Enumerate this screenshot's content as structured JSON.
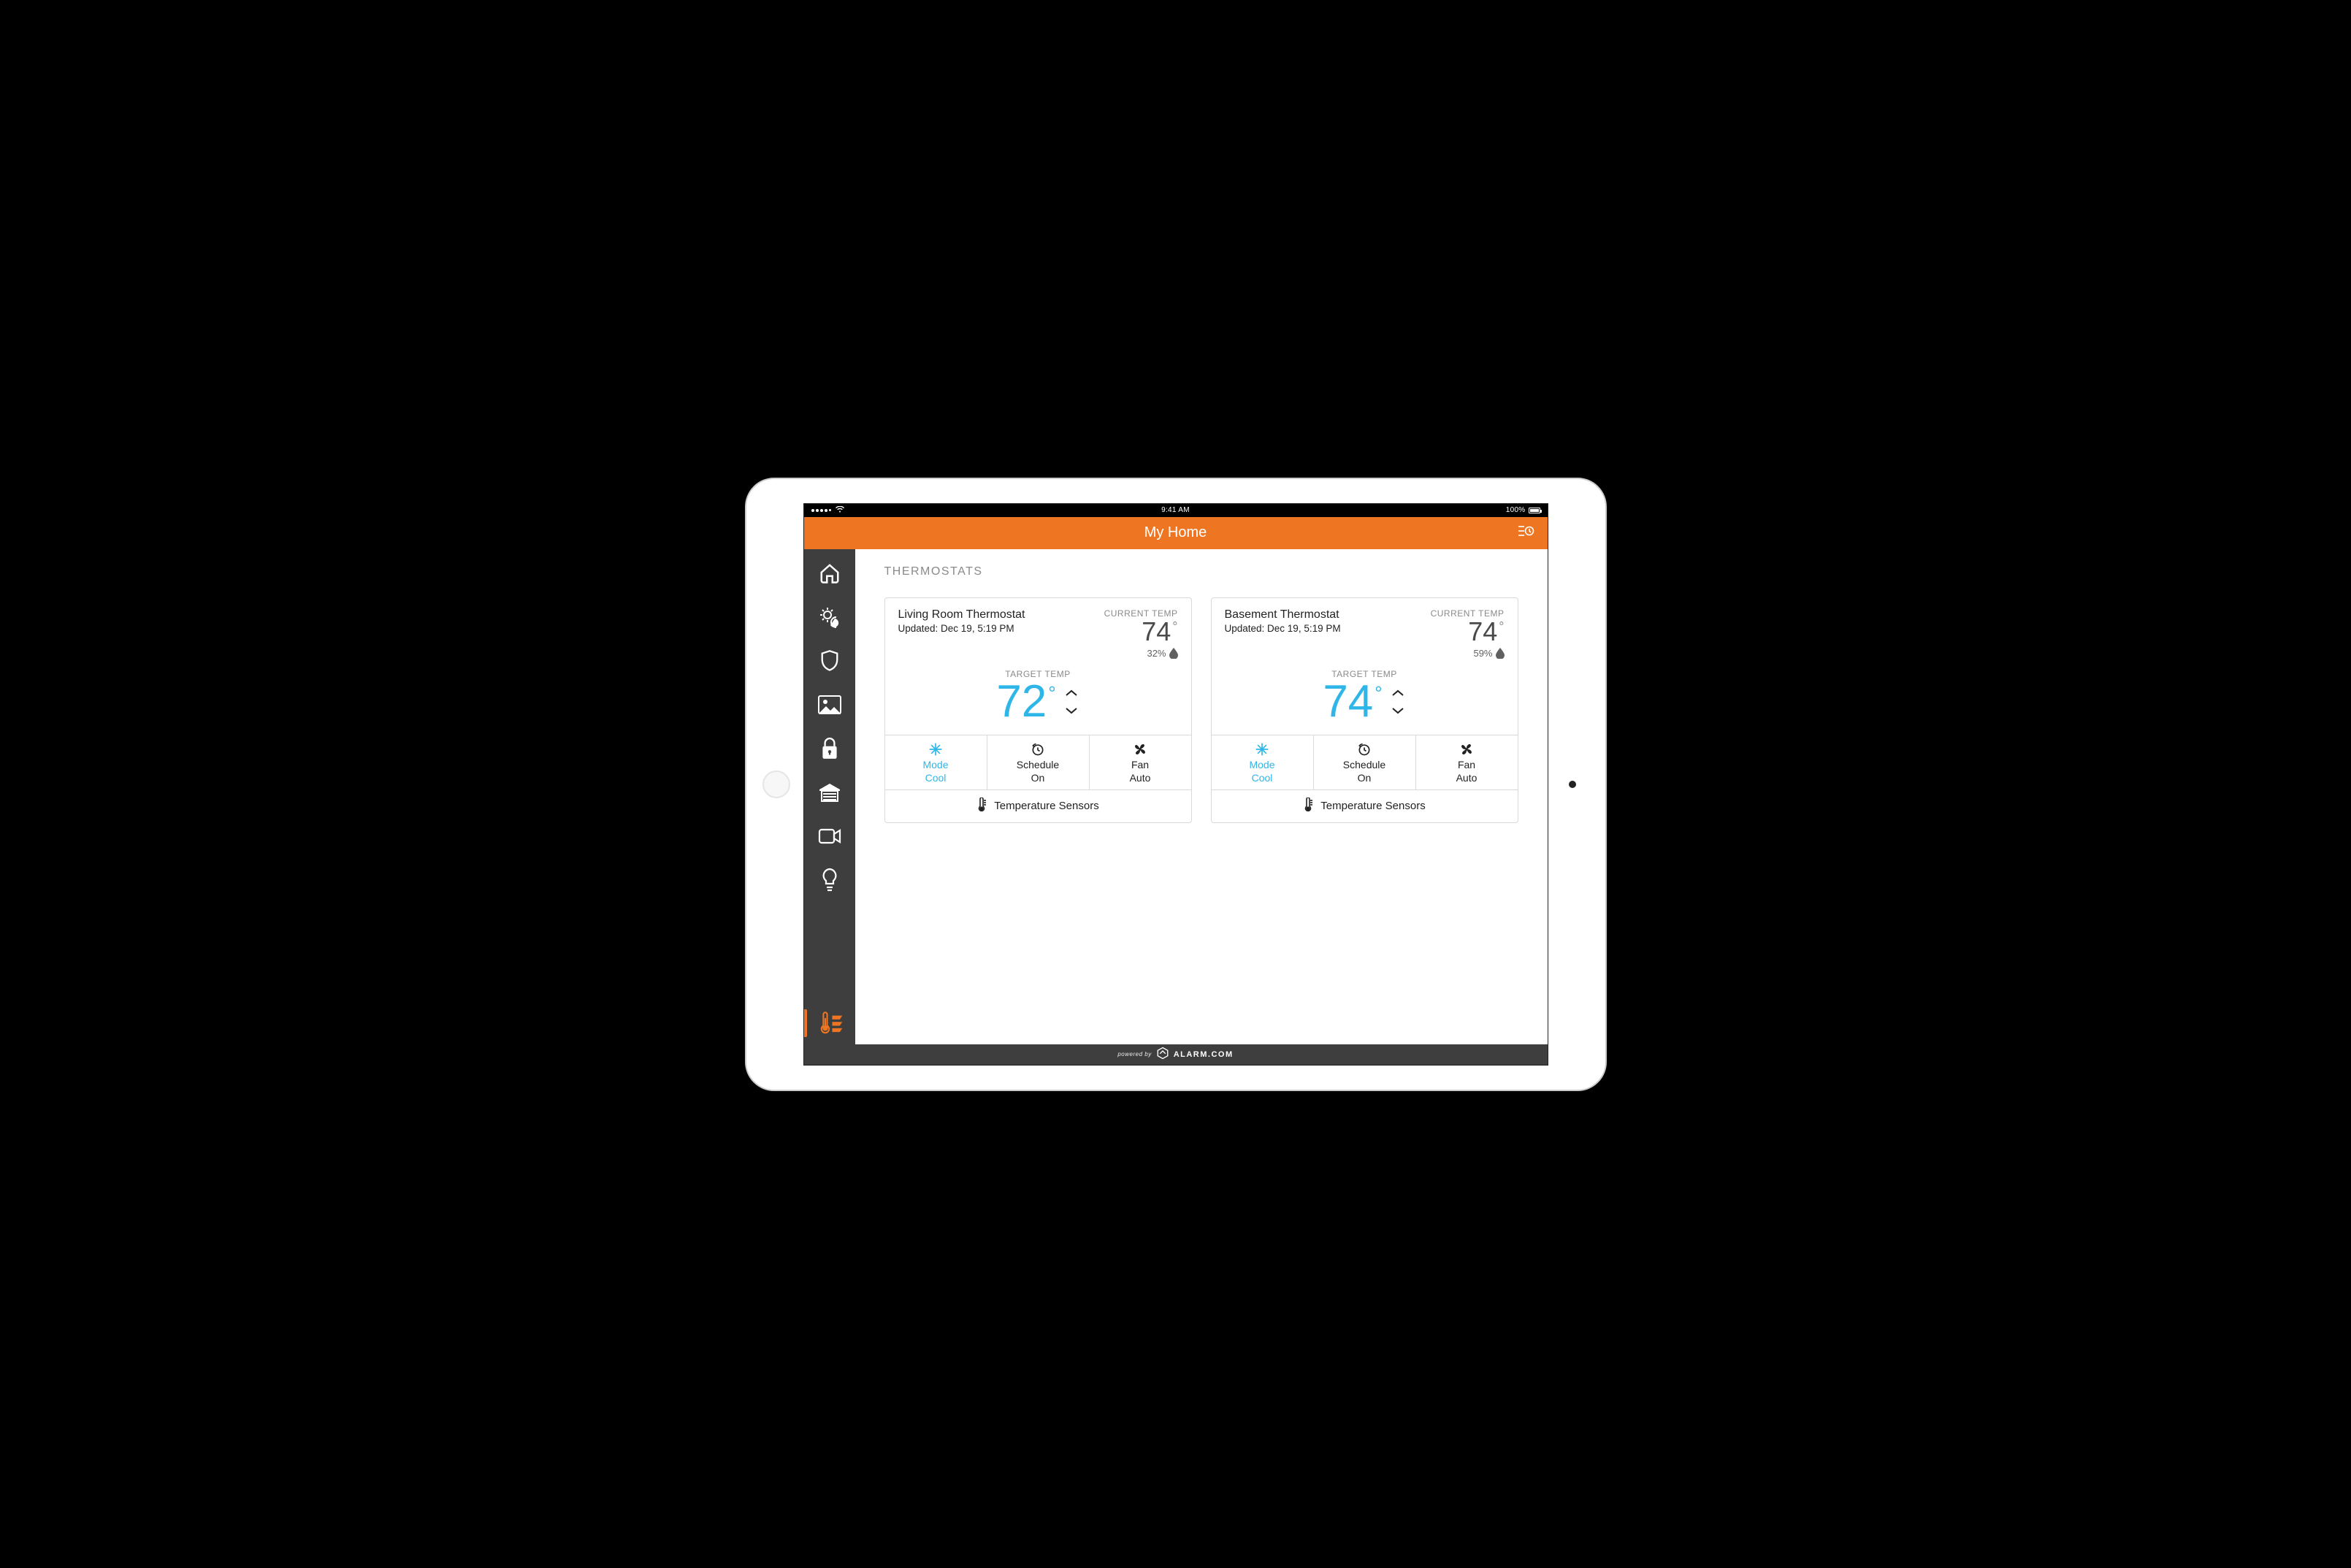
{
  "status_bar": {
    "time": "9:41 AM",
    "battery_label": "100%"
  },
  "header": {
    "title": "My Home"
  },
  "section_title": "THERMOSTATS",
  "accent_color": "#ee7623",
  "cool_color": "#2fb6e8",
  "labels": {
    "current_temp": "CURRENT TEMP",
    "target_temp": "TARGET TEMP",
    "mode": "Mode",
    "schedule": "Schedule",
    "fan": "Fan",
    "sensors": "Temperature Sensors"
  },
  "thermostats": [
    {
      "name": "Living Room Thermostat",
      "updated": "Updated: Dec 19, 5:19 PM",
      "current_temp": "74",
      "humidity": "32%",
      "target_temp": "72",
      "mode_value": "Cool",
      "schedule_value": "On",
      "fan_value": "Auto"
    },
    {
      "name": "Basement Thermostat",
      "updated": "Updated: Dec 19, 5:19 PM",
      "current_temp": "74",
      "humidity": "59%",
      "target_temp": "74",
      "mode_value": "Cool",
      "schedule_value": "On",
      "fan_value": "Auto"
    }
  ],
  "footer": {
    "powered_by": "powered by",
    "brand": "ALARM.COM"
  }
}
